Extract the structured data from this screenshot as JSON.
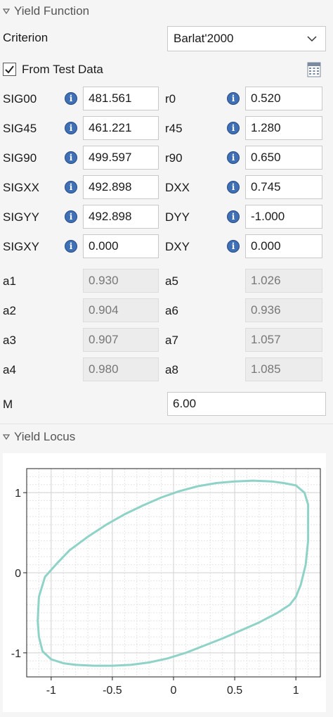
{
  "yield_function": {
    "section_title": "Yield Function",
    "criterion_label": "Criterion",
    "criterion_value": "Barlat'2000",
    "from_test_data_label": "From Test Data",
    "from_test_data_checked": true,
    "left_params": [
      {
        "label": "SIG00",
        "value": "481.561"
      },
      {
        "label": "SIG45",
        "value": "461.221"
      },
      {
        "label": "SIG90",
        "value": "499.597"
      },
      {
        "label": "SIGXX",
        "value": "492.898"
      },
      {
        "label": "SIGYY",
        "value": "492.898"
      },
      {
        "label": "SIGXY",
        "value": "0.000"
      }
    ],
    "right_params": [
      {
        "label": "r0",
        "value": "0.520"
      },
      {
        "label": "r45",
        "value": "1.280"
      },
      {
        "label": "r90",
        "value": "0.650"
      },
      {
        "label": "DXX",
        "value": "0.745"
      },
      {
        "label": "DYY",
        "value": "-1.000"
      },
      {
        "label": "DXY",
        "value": "0.000"
      }
    ],
    "coeffs_left": [
      {
        "label": "a1",
        "value": "0.930"
      },
      {
        "label": "a2",
        "value": "0.904"
      },
      {
        "label": "a3",
        "value": "0.907"
      },
      {
        "label": "a4",
        "value": "0.980"
      }
    ],
    "coeffs_right": [
      {
        "label": "a5",
        "value": "1.026"
      },
      {
        "label": "a6",
        "value": "0.936"
      },
      {
        "label": "a7",
        "value": "1.057"
      },
      {
        "label": "a8",
        "value": "1.085"
      }
    ],
    "m_label": "M",
    "m_value": "6.00"
  },
  "yield_locus": {
    "section_title": "Yield Locus"
  },
  "colors": {
    "curve": "#8fd3c8",
    "info_icon": "#3f6fb5"
  },
  "chart_data": {
    "type": "line",
    "title": "",
    "xlabel": "",
    "ylabel": "",
    "xlim": [
      -1.2,
      1.2
    ],
    "ylim": [
      -1.3,
      1.3
    ],
    "xticks": [
      "-1",
      "-0.5",
      "0",
      "0.5",
      "1"
    ],
    "yticks": [
      "-1",
      "0",
      "1"
    ],
    "grid": true,
    "series": [
      {
        "x": [
          1.1,
          1.1,
          1.08,
          1.04,
          1.0,
          0.95,
          0.85,
          0.7,
          0.55,
          0.4,
          0.25,
          0.1,
          -0.05,
          -0.2,
          -0.35,
          -0.5,
          -0.65,
          -0.8,
          -0.9,
          -1.0,
          -1.07,
          -1.1,
          -1.11,
          -1.1,
          -1.05,
          -0.95,
          -0.85,
          -0.7,
          -0.55,
          -0.4,
          -0.25,
          -0.1,
          0.05,
          0.2,
          0.35,
          0.5,
          0.65,
          0.8,
          0.9,
          1.0,
          1.07,
          1.1
        ],
        "y": [
          0.7,
          0.4,
          0.1,
          -0.15,
          -0.3,
          -0.4,
          -0.5,
          -0.62,
          -0.72,
          -0.82,
          -0.91,
          -1.0,
          -1.07,
          -1.12,
          -1.15,
          -1.16,
          -1.16,
          -1.15,
          -1.13,
          -1.08,
          -0.98,
          -0.8,
          -0.6,
          -0.3,
          -0.05,
          0.12,
          0.28,
          0.45,
          0.6,
          0.73,
          0.84,
          0.94,
          1.02,
          1.08,
          1.12,
          1.14,
          1.15,
          1.14,
          1.12,
          1.09,
          1.0,
          0.85
        ]
      }
    ]
  }
}
